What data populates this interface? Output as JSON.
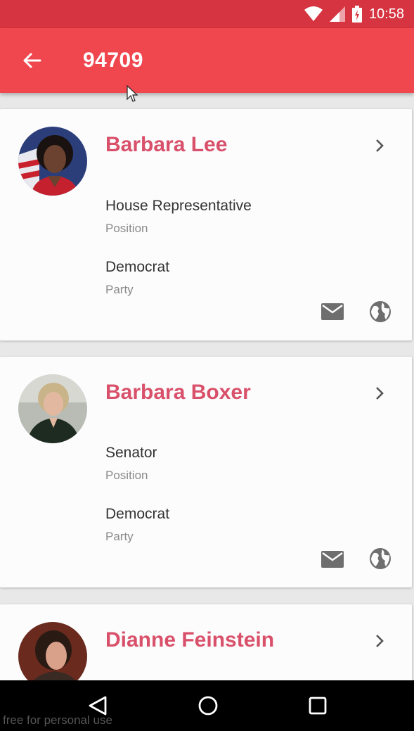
{
  "status_bar": {
    "time": "10:58"
  },
  "app_bar": {
    "title": "94709"
  },
  "representatives": [
    {
      "name": "Barbara Lee",
      "position": "House Representative",
      "position_label": "Position",
      "party": "Democrat",
      "party_label": "Party"
    },
    {
      "name": "Barbara Boxer",
      "position": "Senator",
      "position_label": "Position",
      "party": "Democrat",
      "party_label": "Party"
    },
    {
      "name": "Dianne Feinstein"
    }
  ],
  "colors": {
    "status_bar": "#d63441",
    "app_bar": "#f0474f",
    "name_text": "#d9506a"
  },
  "watermark": "free for personal use"
}
